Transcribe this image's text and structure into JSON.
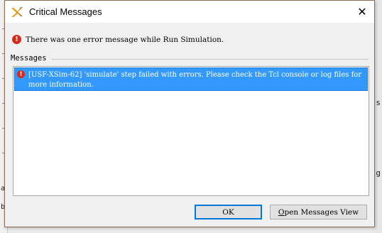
{
  "window": {
    "title": "Critical Messages",
    "close_glyph": "✕"
  },
  "summary": {
    "text": "There was one error message while Run Simulation.",
    "icon": "error-icon"
  },
  "messages_section": {
    "label": "Messages",
    "items": [
      {
        "icon": "error-icon",
        "text": "[USF-XSim-62] 'simulate' step failed with errors. Please check the Tcl console or log files for more information."
      }
    ]
  },
  "buttons": {
    "ok_label": "OK",
    "open_view_mnemonic": "O",
    "open_view_rest": "pen Messages View"
  },
  "background": {
    "right_chars": [
      "s",
      "g"
    ],
    "left_chars": [
      "a",
      "b"
    ]
  },
  "colors": {
    "selection": "#3399ff",
    "error": "#d52b1e",
    "dialog_border": "#8c6d4f"
  }
}
